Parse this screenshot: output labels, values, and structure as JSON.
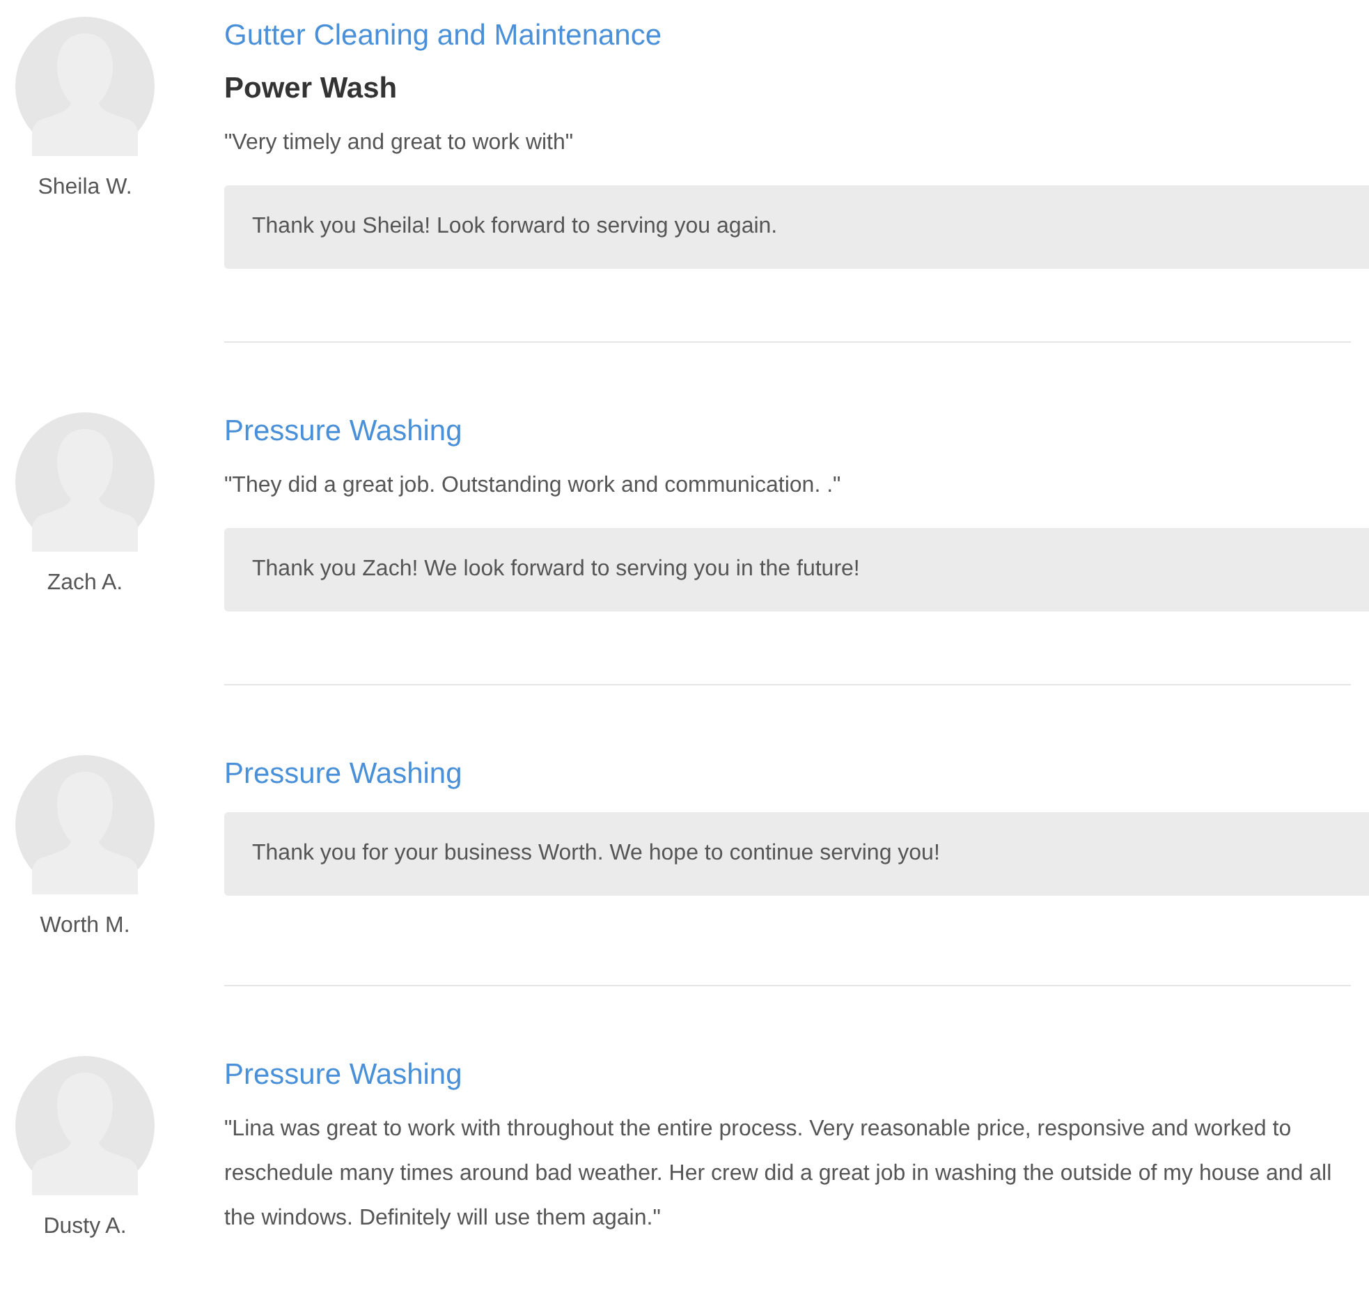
{
  "reviews": [
    {
      "name": "Sheila W.",
      "service": "Gutter Cleaning and Maintenance",
      "subtitle": "Power Wash",
      "quote": "\"Very timely and great to work with\"",
      "reply": "Thank you Sheila! Look forward to serving you again."
    },
    {
      "name": "Zach A.",
      "service": "Pressure Washing",
      "quote": "\"They did a great job. Outstanding work and communication. .\"",
      "reply": "Thank you Zach! We look forward to serving you in the future!"
    },
    {
      "name": "Worth M.",
      "service": "Pressure Washing",
      "reply": "Thank you for your business Worth. We hope to continue serving you!"
    },
    {
      "name": "Dusty A.",
      "service": "Pressure Washing",
      "quote": "\"Lina was great to work with throughout the entire process. Very reasonable price, responsive and worked to reschedule many times around bad weather. Her crew did a great job in washing the outside of my house and all the windows. Definitely will use them again.\""
    }
  ]
}
